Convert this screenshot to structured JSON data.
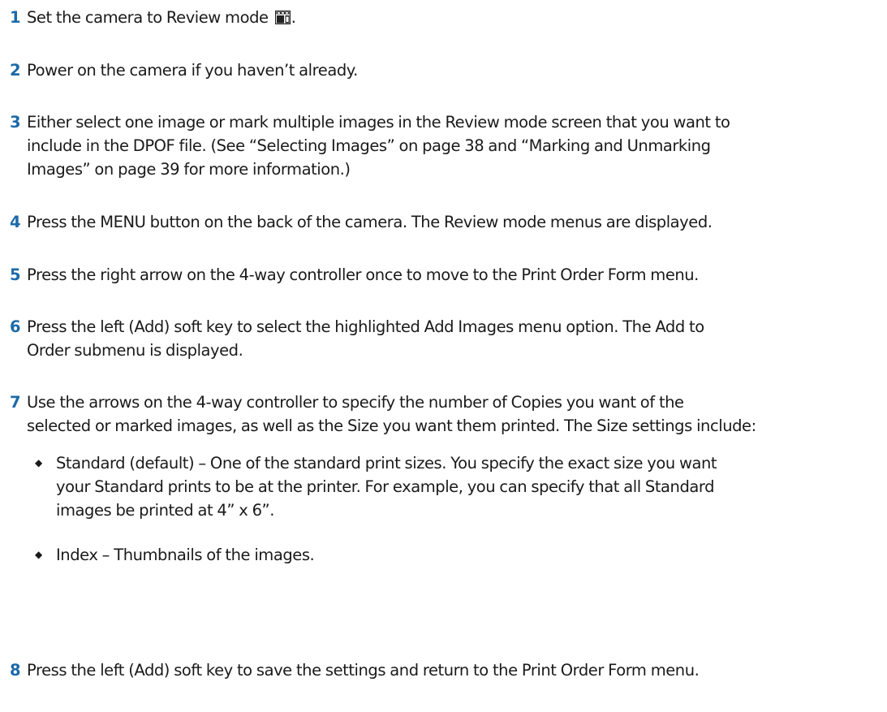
{
  "steps": [
    {
      "num": "1",
      "text_before_icon": "Set the camera to Review mode",
      "icon": "review-mode-icon",
      "text_after_icon": "."
    },
    {
      "num": "2",
      "text": "Power on the camera if you haven’t already."
    },
    {
      "num": "3",
      "lines": [
        "Either select one image or mark multiple images in the Review mode screen that you want to",
        "include in the DPOF file. (See “Selecting Images” on page 38 and “Marking and Unmarking",
        "Images” on page 39 for more information.)"
      ]
    },
    {
      "num": "4",
      "text": "Press the MENU button on the back of the camera. The Review mode menus are displayed."
    },
    {
      "num": "5",
      "text": "Press the right arrow on the 4-way controller once to move to the Print Order Form menu."
    },
    {
      "num": "6",
      "lines": [
        "Press the left (Add) soft key to select the highlighted Add Images menu option. The Add to",
        "Order submenu is displayed."
      ]
    },
    {
      "num": "7",
      "lines": [
        "Use the arrows on the 4-way controller to specify the number of Copies you want of the",
        "selected or marked images, as well as the Size you want them printed. The Size settings include:"
      ],
      "bullets": [
        {
          "marker": "◆",
          "lines": [
            "Standard (default) – One of the standard print sizes. You specify the exact size you want",
            "your Standard prints to be at the printer. For example, you can specify that all Standard",
            "images be printed at 4” x 6”."
          ]
        },
        {
          "marker": "◆",
          "lines": [
            "Index  – Thumbnails of the images."
          ]
        }
      ]
    },
    {
      "num": "8",
      "text": "Press the left (Add) soft key to save the settings and return to the Print Order Form menu."
    }
  ]
}
